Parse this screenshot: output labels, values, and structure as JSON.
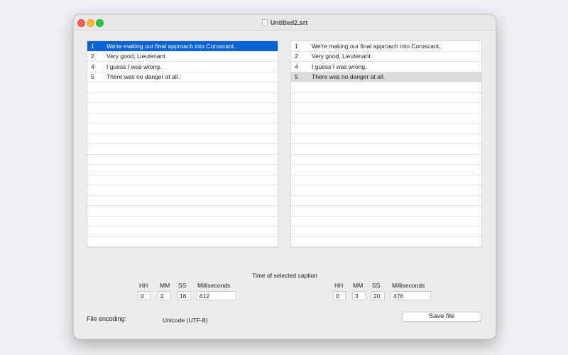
{
  "window": {
    "title": "Untitled2.srt"
  },
  "left_list": {
    "rows": [
      {
        "num": "1",
        "text": "We're making our final approach into Coruscant.",
        "selected": true
      },
      {
        "num": "2",
        "text": "Very good, Lieutenant."
      },
      {
        "num": "4",
        "text": "I guess I was wrong."
      },
      {
        "num": "5",
        "text": "There was no danger at all."
      }
    ]
  },
  "right_list": {
    "rows": [
      {
        "num": "1",
        "text": "We're making our final approach into Coruscant."
      },
      {
        "num": "2",
        "text": "Very good, Lieutenant."
      },
      {
        "num": "4",
        "text": "I guess I was wrong."
      },
      {
        "num": "5",
        "text": "There was no danger at all.",
        "highlighted": true
      }
    ]
  },
  "time_section": {
    "title": "Time of selected caption",
    "labels": {
      "hh": "HH",
      "mm": "MM",
      "ss": "SS",
      "ms": "Milliseconds"
    },
    "left": {
      "hh": "0",
      "mm": "2",
      "ss": "16",
      "ms": "612"
    },
    "right": {
      "hh": "0",
      "mm": "3",
      "ss": "20",
      "ms": "476"
    }
  },
  "encoding": {
    "label": "File encoding:",
    "value": "Unicode (UTF-8)"
  },
  "save_button": {
    "label": "Save file"
  },
  "colors": {
    "selection": "#0a63d3",
    "highlight": "#dcdcdc"
  }
}
